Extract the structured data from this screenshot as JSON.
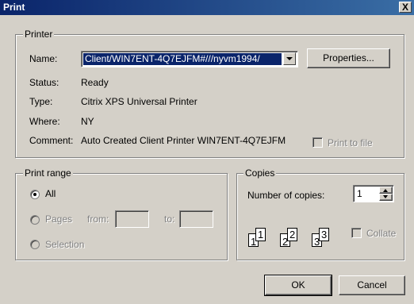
{
  "window": {
    "title": "Print",
    "close_glyph": "X"
  },
  "printer": {
    "group_label": "Printer",
    "name_label": "Name:",
    "name_value": "Client/WIN7ENT-4Q7EJFM#///nyvm1994/",
    "properties_button": "Properties...",
    "status_label": "Status:",
    "status_value": "Ready",
    "type_label": "Type:",
    "type_value": "Citrix XPS Universal Printer",
    "where_label": "Where:",
    "where_value": "NY",
    "comment_label": "Comment:",
    "comment_value": "Auto Created Client Printer WIN7ENT-4Q7EJFM",
    "print_to_file_label": "Print to file",
    "print_to_file_checked": false
  },
  "print_range": {
    "group_label": "Print range",
    "all_label": "All",
    "pages_label": "Pages",
    "from_label": "from:",
    "to_label": "to:",
    "from_value": "",
    "to_value": "",
    "selection_label": "Selection",
    "selected": "All"
  },
  "copies": {
    "group_label": "Copies",
    "number_label": "Number of copies:",
    "number_value": "1",
    "collate_label": "Collate",
    "collate_checked": false,
    "collate_pages": [
      "1",
      "1",
      "2",
      "2",
      "3",
      "3"
    ]
  },
  "buttons": {
    "ok": "OK",
    "cancel": "Cancel"
  },
  "colors": {
    "titlebar": "#0a246a",
    "selection": "#0a246a",
    "face": "#d4d0c8"
  }
}
